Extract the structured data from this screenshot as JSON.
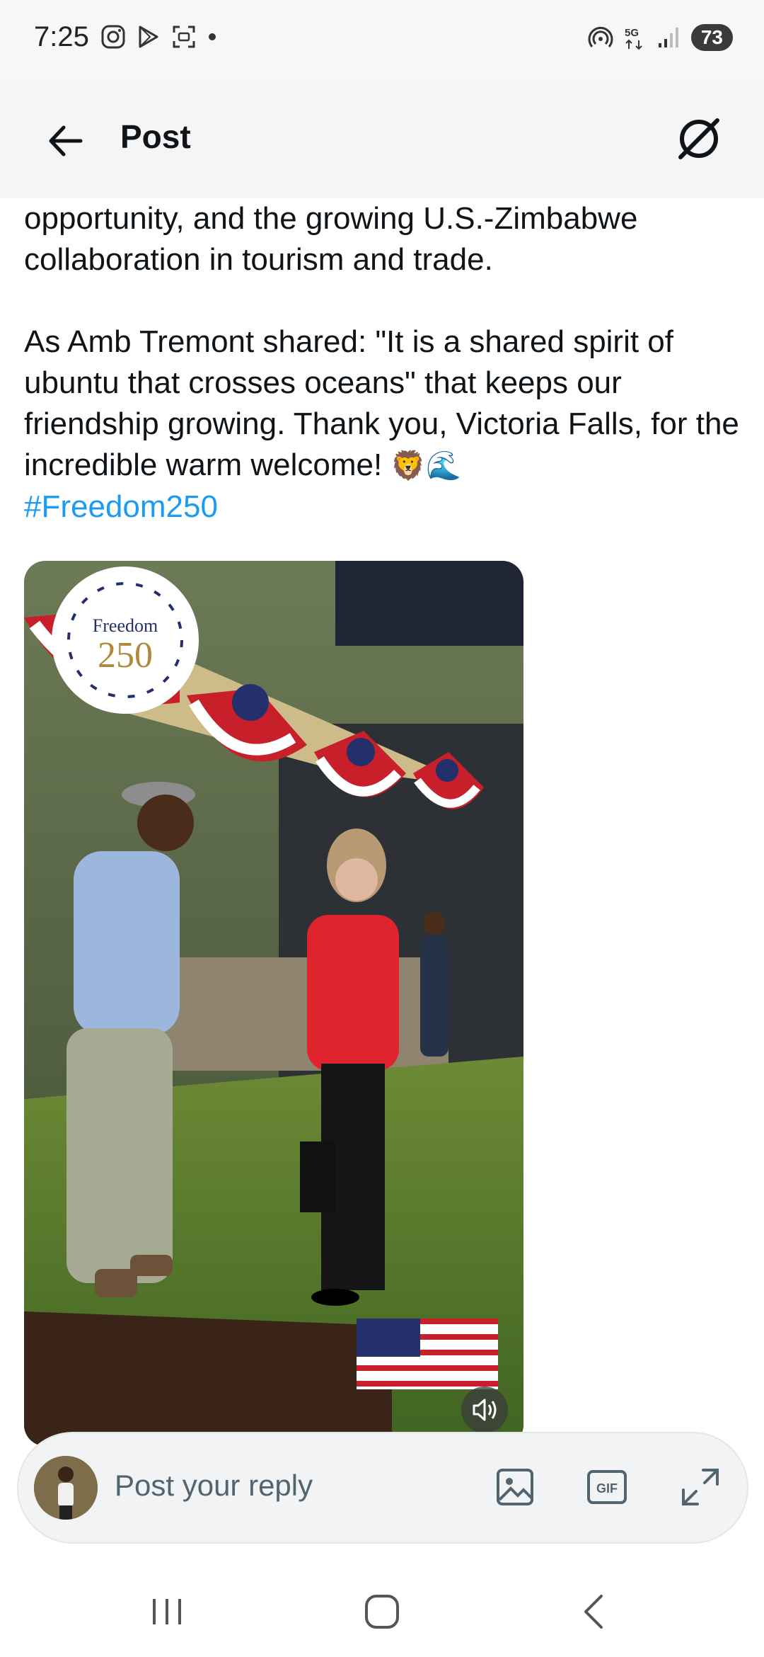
{
  "status_bar": {
    "time": "7:25",
    "left_icons": [
      "instagram-icon",
      "play-store-icon",
      "screenshot-icon",
      "dot-icon"
    ],
    "right_icons": [
      "hotspot-icon",
      "5g-icon",
      "signal-icon"
    ],
    "battery": "73"
  },
  "header": {
    "title": "Post",
    "back_icon": "back-arrow-icon",
    "grok_icon": "grok-icon"
  },
  "post": {
    "text_line_1": "opportunity, and the growing U.S.-Zimbabwe collaboration in tourism and trade.",
    "text_line_2": "As Amb Tremont shared: \"It is a shared spirit of ubuntu that crosses oceans\" that keeps our friendship growing. Thank you, Victoria Falls, for the incredible warm welcome! ",
    "emojis": "🦁🌊",
    "hashtag": "#Freedom250"
  },
  "media": {
    "badge_top": "Freedom",
    "badge_number": "250",
    "mute_icon": "volume-icon"
  },
  "reply_bar": {
    "placeholder": "Post your reply",
    "icons": [
      "image-icon",
      "gif-icon",
      "expand-icon"
    ],
    "gif_label": "GIF"
  },
  "nav_bar": {
    "icons": [
      "recent-apps-icon",
      "home-icon",
      "back-icon"
    ]
  },
  "colors": {
    "link": "#1d9bf0",
    "text": "#0f1419",
    "placeholder": "#536471"
  }
}
